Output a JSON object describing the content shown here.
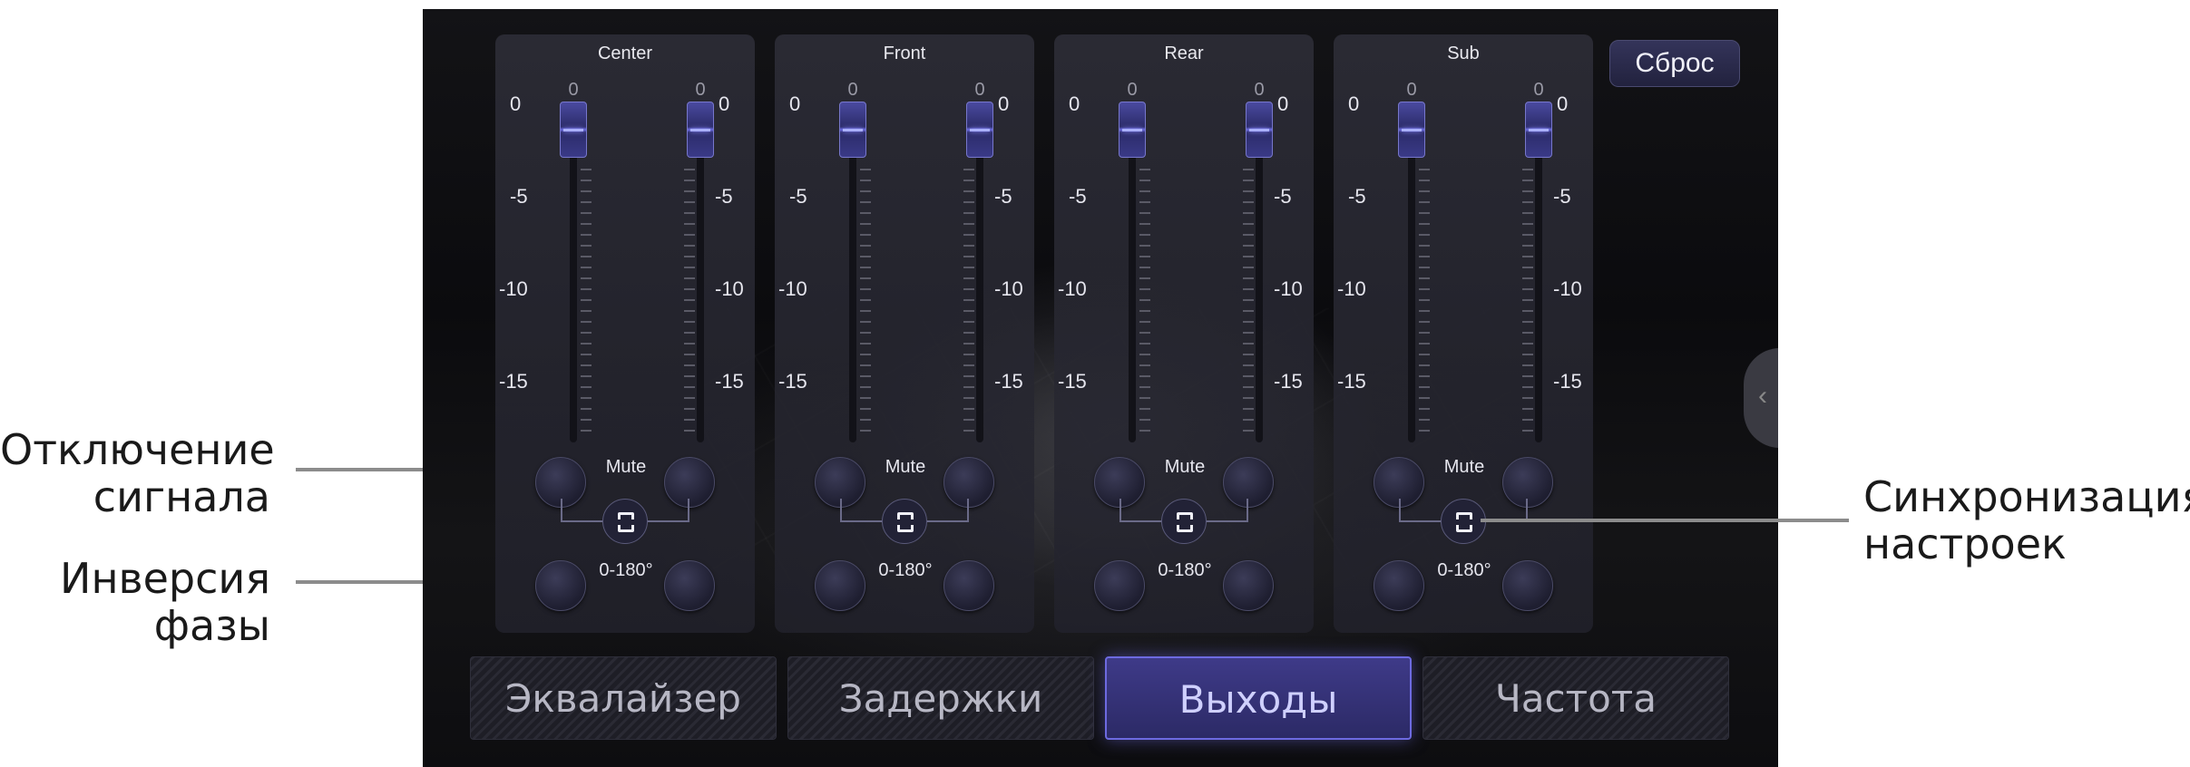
{
  "callouts": {
    "mute": [
      "Отключение",
      "сигнала"
    ],
    "phase": [
      "Инверсия",
      "фазы"
    ],
    "sync": [
      "Синхронизация",
      "настроек"
    ]
  },
  "reset_label": "Сброс",
  "scale": [
    "0",
    "-5",
    "-10",
    "-15"
  ],
  "mute_label": "Mute",
  "phase_label": "0-180°",
  "panels": [
    {
      "title": "Center",
      "faders": [
        {
          "value": "0",
          "level_db": 0
        },
        {
          "value": "0",
          "level_db": 0
        }
      ]
    },
    {
      "title": "Front",
      "faders": [
        {
          "value": "0",
          "level_db": 0
        },
        {
          "value": "0",
          "level_db": 0
        }
      ]
    },
    {
      "title": "Rear",
      "faders": [
        {
          "value": "0",
          "level_db": 0
        },
        {
          "value": "0",
          "level_db": 0
        }
      ]
    },
    {
      "title": "Sub",
      "faders": [
        {
          "value": "0",
          "level_db": 0
        },
        {
          "value": "0",
          "level_db": 0
        }
      ]
    }
  ],
  "tabs": [
    {
      "label": "Эквалайзер",
      "active": false
    },
    {
      "label": "Задержки",
      "active": false
    },
    {
      "label": "Выходы",
      "active": true
    },
    {
      "label": "Частота",
      "active": false
    }
  ],
  "icons": {
    "sync": "link-sync-icon",
    "collapse": "chevron-left-icon"
  },
  "colors": {
    "accent": "#6d6ae0",
    "background": "#0d0d10"
  }
}
